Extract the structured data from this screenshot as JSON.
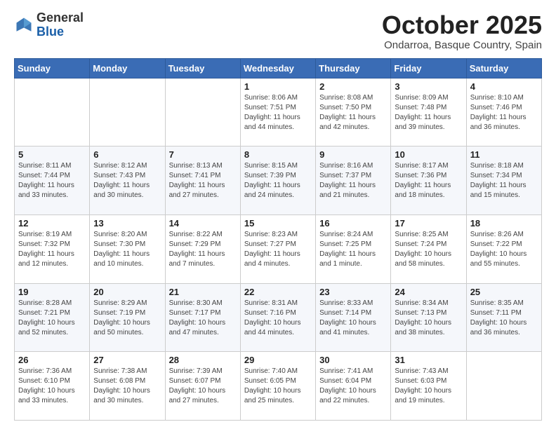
{
  "header": {
    "logo_general": "General",
    "logo_blue": "Blue",
    "month_title": "October 2025",
    "location": "Ondarroa, Basque Country, Spain"
  },
  "days_of_week": [
    "Sunday",
    "Monday",
    "Tuesday",
    "Wednesday",
    "Thursday",
    "Friday",
    "Saturday"
  ],
  "weeks": [
    [
      {
        "day": "",
        "info": ""
      },
      {
        "day": "",
        "info": ""
      },
      {
        "day": "",
        "info": ""
      },
      {
        "day": "1",
        "info": "Sunrise: 8:06 AM\nSunset: 7:51 PM\nDaylight: 11 hours\nand 44 minutes."
      },
      {
        "day": "2",
        "info": "Sunrise: 8:08 AM\nSunset: 7:50 PM\nDaylight: 11 hours\nand 42 minutes."
      },
      {
        "day": "3",
        "info": "Sunrise: 8:09 AM\nSunset: 7:48 PM\nDaylight: 11 hours\nand 39 minutes."
      },
      {
        "day": "4",
        "info": "Sunrise: 8:10 AM\nSunset: 7:46 PM\nDaylight: 11 hours\nand 36 minutes."
      }
    ],
    [
      {
        "day": "5",
        "info": "Sunrise: 8:11 AM\nSunset: 7:44 PM\nDaylight: 11 hours\nand 33 minutes."
      },
      {
        "day": "6",
        "info": "Sunrise: 8:12 AM\nSunset: 7:43 PM\nDaylight: 11 hours\nand 30 minutes."
      },
      {
        "day": "7",
        "info": "Sunrise: 8:13 AM\nSunset: 7:41 PM\nDaylight: 11 hours\nand 27 minutes."
      },
      {
        "day": "8",
        "info": "Sunrise: 8:15 AM\nSunset: 7:39 PM\nDaylight: 11 hours\nand 24 minutes."
      },
      {
        "day": "9",
        "info": "Sunrise: 8:16 AM\nSunset: 7:37 PM\nDaylight: 11 hours\nand 21 minutes."
      },
      {
        "day": "10",
        "info": "Sunrise: 8:17 AM\nSunset: 7:36 PM\nDaylight: 11 hours\nand 18 minutes."
      },
      {
        "day": "11",
        "info": "Sunrise: 8:18 AM\nSunset: 7:34 PM\nDaylight: 11 hours\nand 15 minutes."
      }
    ],
    [
      {
        "day": "12",
        "info": "Sunrise: 8:19 AM\nSunset: 7:32 PM\nDaylight: 11 hours\nand 12 minutes."
      },
      {
        "day": "13",
        "info": "Sunrise: 8:20 AM\nSunset: 7:30 PM\nDaylight: 11 hours\nand 10 minutes."
      },
      {
        "day": "14",
        "info": "Sunrise: 8:22 AM\nSunset: 7:29 PM\nDaylight: 11 hours\nand 7 minutes."
      },
      {
        "day": "15",
        "info": "Sunrise: 8:23 AM\nSunset: 7:27 PM\nDaylight: 11 hours\nand 4 minutes."
      },
      {
        "day": "16",
        "info": "Sunrise: 8:24 AM\nSunset: 7:25 PM\nDaylight: 11 hours\nand 1 minute."
      },
      {
        "day": "17",
        "info": "Sunrise: 8:25 AM\nSunset: 7:24 PM\nDaylight: 10 hours\nand 58 minutes."
      },
      {
        "day": "18",
        "info": "Sunrise: 8:26 AM\nSunset: 7:22 PM\nDaylight: 10 hours\nand 55 minutes."
      }
    ],
    [
      {
        "day": "19",
        "info": "Sunrise: 8:28 AM\nSunset: 7:21 PM\nDaylight: 10 hours\nand 52 minutes."
      },
      {
        "day": "20",
        "info": "Sunrise: 8:29 AM\nSunset: 7:19 PM\nDaylight: 10 hours\nand 50 minutes."
      },
      {
        "day": "21",
        "info": "Sunrise: 8:30 AM\nSunset: 7:17 PM\nDaylight: 10 hours\nand 47 minutes."
      },
      {
        "day": "22",
        "info": "Sunrise: 8:31 AM\nSunset: 7:16 PM\nDaylight: 10 hours\nand 44 minutes."
      },
      {
        "day": "23",
        "info": "Sunrise: 8:33 AM\nSunset: 7:14 PM\nDaylight: 10 hours\nand 41 minutes."
      },
      {
        "day": "24",
        "info": "Sunrise: 8:34 AM\nSunset: 7:13 PM\nDaylight: 10 hours\nand 38 minutes."
      },
      {
        "day": "25",
        "info": "Sunrise: 8:35 AM\nSunset: 7:11 PM\nDaylight: 10 hours\nand 36 minutes."
      }
    ],
    [
      {
        "day": "26",
        "info": "Sunrise: 7:36 AM\nSunset: 6:10 PM\nDaylight: 10 hours\nand 33 minutes."
      },
      {
        "day": "27",
        "info": "Sunrise: 7:38 AM\nSunset: 6:08 PM\nDaylight: 10 hours\nand 30 minutes."
      },
      {
        "day": "28",
        "info": "Sunrise: 7:39 AM\nSunset: 6:07 PM\nDaylight: 10 hours\nand 27 minutes."
      },
      {
        "day": "29",
        "info": "Sunrise: 7:40 AM\nSunset: 6:05 PM\nDaylight: 10 hours\nand 25 minutes."
      },
      {
        "day": "30",
        "info": "Sunrise: 7:41 AM\nSunset: 6:04 PM\nDaylight: 10 hours\nand 22 minutes."
      },
      {
        "day": "31",
        "info": "Sunrise: 7:43 AM\nSunset: 6:03 PM\nDaylight: 10 hours\nand 19 minutes."
      },
      {
        "day": "",
        "info": ""
      }
    ]
  ]
}
